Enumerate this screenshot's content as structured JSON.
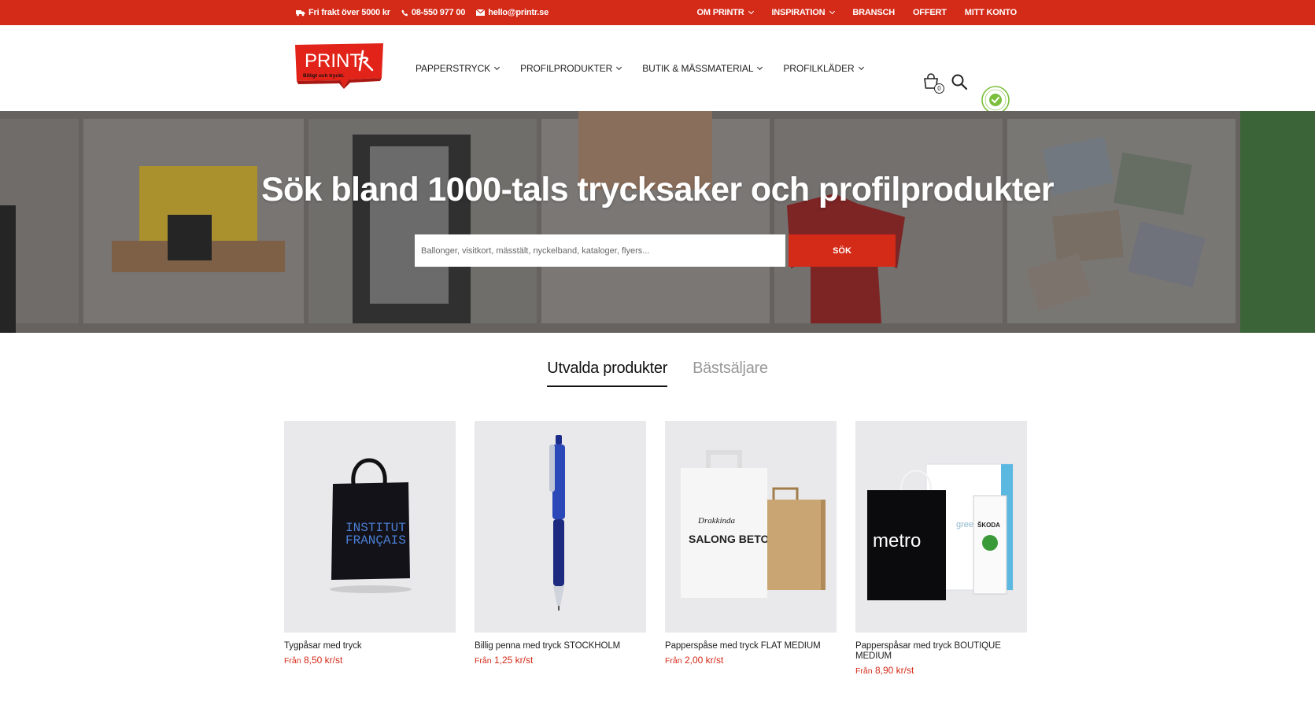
{
  "topbar": {
    "shipping": "Fri frakt över 5000 kr",
    "phone": "08-550 977 00",
    "email": "hello@printr.se",
    "nav": [
      "OM PRINTR",
      "INSPIRATION",
      "BRANSCH",
      "OFFERT",
      "MITT KONTO"
    ],
    "nav_dropdown": [
      true,
      true,
      false,
      false,
      false
    ]
  },
  "logo": {
    "brand": "PRINTR",
    "tagline": "Billigt och tryckt."
  },
  "header": {
    "nav": [
      "PAPPERSTRYCK",
      "PROFILPRODUKTER",
      "BUTIK & MÄSSMATERIAL",
      "PROFILKLÄDER"
    ],
    "cart_count": "0",
    "cert_label": "CERTIFIERAD E-HANDEL"
  },
  "hero": {
    "title": "Sök bland 1000-tals trycksaker och profilprodukter",
    "search_placeholder": "Ballonger, visitkort, mässtält, nyckelband, kataloger, flyers...",
    "search_button": "SÖK"
  },
  "tabs": [
    "Utvalda produkter",
    "Bästsäljare"
  ],
  "products": [
    {
      "name": "Tygpåsar med tryck",
      "from": "Från",
      "price": "8,50 kr/st"
    },
    {
      "name": "Billig penna med tryck STOCKHOLM",
      "from": "Från",
      "price": "1,25 kr/st"
    },
    {
      "name": "Papperspåse med tryck FLAT MEDIUM",
      "from": "Från",
      "price": "2,00 kr/st"
    },
    {
      "name": "Papperspåsar med tryck BOUTIQUE MEDIUM",
      "from": "Från",
      "price": "8,90 kr/st"
    }
  ],
  "colors": {
    "accent": "#d42a18",
    "text": "#222222",
    "product_bg": "#e9e9eb"
  }
}
